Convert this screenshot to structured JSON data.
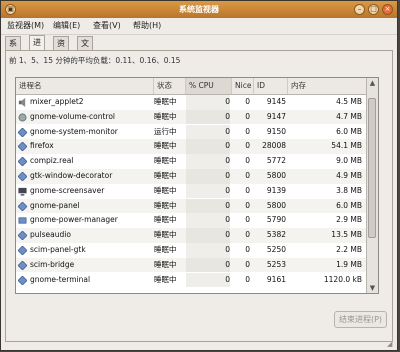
{
  "window": {
    "title": "系统监视器"
  },
  "menubar": {
    "items": [
      "监视器(M)",
      "编辑(E)",
      "查看(V)",
      "帮助(H)"
    ]
  },
  "tabs": [
    {
      "label": "系统",
      "active": false
    },
    {
      "label": "进程",
      "active": true
    },
    {
      "label": "资源",
      "active": false
    },
    {
      "label": "文件系统",
      "active": false
    }
  ],
  "load": {
    "text": "前 1、5、15 分钟的平均负载：0.11、0.16、0.15"
  },
  "table": {
    "columns": [
      "进程名",
      "状态",
      "% CPU",
      "Nice",
      "ID",
      "内存"
    ],
    "rows": [
      {
        "name": "mixer_applet2",
        "status": "睡眠中",
        "cpu": "0",
        "nice": "0",
        "id": "9145",
        "mem": "4.5 MB",
        "icon": "speaker-icon"
      },
      {
        "name": "gnome-volume-control",
        "status": "睡眠中",
        "cpu": "0",
        "nice": "0",
        "id": "9147",
        "mem": "4.7 MB",
        "icon": "volume-icon"
      },
      {
        "name": "gnome-system-monitor",
        "status": "运行中",
        "cpu": "0",
        "nice": "0",
        "id": "9150",
        "mem": "6.0 MB",
        "icon": "diamond-icon"
      },
      {
        "name": "firefox",
        "status": "睡眠中",
        "cpu": "0",
        "nice": "0",
        "id": "28008",
        "mem": "54.1 MB",
        "icon": "diamond-icon"
      },
      {
        "name": "compiz.real",
        "status": "睡眠中",
        "cpu": "0",
        "nice": "0",
        "id": "5772",
        "mem": "9.0 MB",
        "icon": "diamond-icon"
      },
      {
        "name": "gtk-window-decorator",
        "status": "睡眠中",
        "cpu": "0",
        "nice": "0",
        "id": "5800",
        "mem": "4.9 MB",
        "icon": "diamond-icon"
      },
      {
        "name": "gnome-screensaver",
        "status": "睡眠中",
        "cpu": "0",
        "nice": "0",
        "id": "9139",
        "mem": "3.8 MB",
        "icon": "monitor-icon"
      },
      {
        "name": "gnome-panel",
        "status": "睡眠中",
        "cpu": "0",
        "nice": "0",
        "id": "5800",
        "mem": "6.0 MB",
        "icon": "diamond-icon"
      },
      {
        "name": "gnome-power-manager",
        "status": "睡眠中",
        "cpu": "0",
        "nice": "0",
        "id": "5790",
        "mem": "2.9 MB",
        "icon": "power-icon"
      },
      {
        "name": "pulseaudio",
        "status": "睡眠中",
        "cpu": "0",
        "nice": "0",
        "id": "5382",
        "mem": "13.5 MB",
        "icon": "diamond-icon"
      },
      {
        "name": "scim-panel-gtk",
        "status": "睡眠中",
        "cpu": "0",
        "nice": "0",
        "id": "5250",
        "mem": "2.2 MB",
        "icon": "diamond-icon"
      },
      {
        "name": "scim-bridge",
        "status": "睡眠中",
        "cpu": "0",
        "nice": "0",
        "id": "5253",
        "mem": "1.9 MB",
        "icon": "diamond-icon"
      },
      {
        "name": "gnome-terminal",
        "status": "睡眠中",
        "cpu": "0",
        "nice": "0",
        "id": "9161",
        "mem": "1120.0 kB",
        "icon": "diamond-icon"
      }
    ]
  },
  "buttons": {
    "end_process": "结束进程(P)"
  }
}
